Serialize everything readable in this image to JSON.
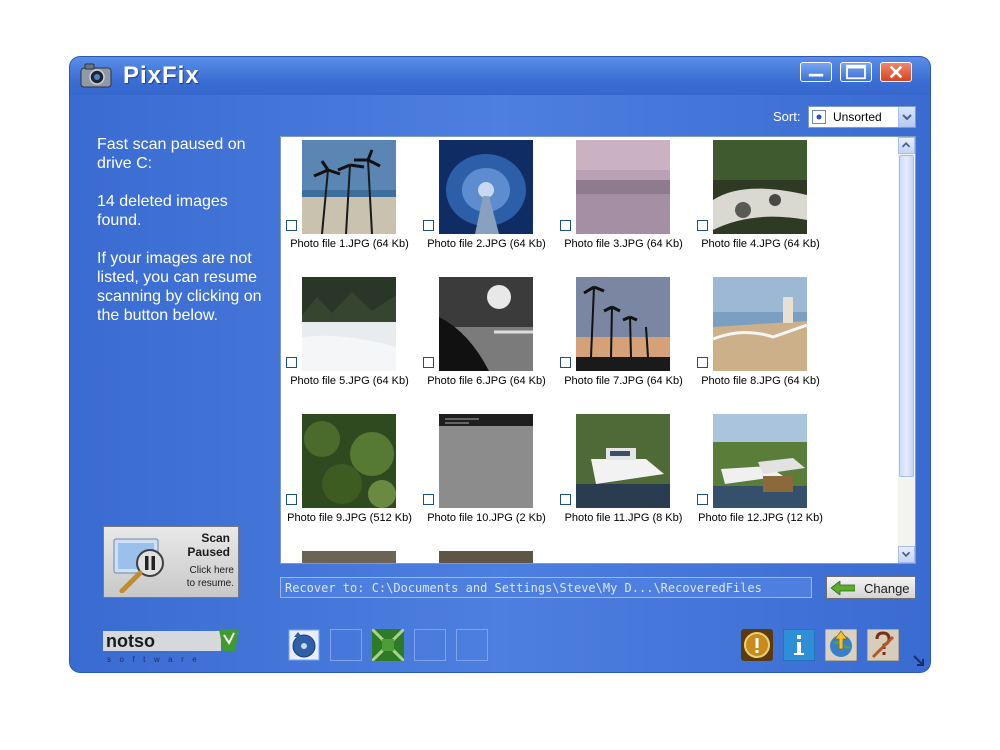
{
  "window": {
    "title": "PixFix"
  },
  "status": {
    "line1": "Fast scan paused on drive C:",
    "line2": "14 deleted images found.",
    "line3": "If your images are not listed, you can resume scanning by clicking on the button below."
  },
  "scan_button": {
    "title_line1": "Scan",
    "title_line2": "Paused",
    "sub_line1": "Click here",
    "sub_line2": "to resume."
  },
  "sort": {
    "label": "Sort:",
    "value": "Unsorted"
  },
  "photos": [
    {
      "name": "Photo file 1.JPG (64 Kb)"
    },
    {
      "name": "Photo file 2.JPG (64 Kb)"
    },
    {
      "name": "Photo file 3.JPG (64 Kb)"
    },
    {
      "name": "Photo file 4.JPG (64 Kb)"
    },
    {
      "name": "Photo file 5.JPG (64 Kb)"
    },
    {
      "name": "Photo file 6.JPG (64 Kb)"
    },
    {
      "name": "Photo file 7.JPG (64 Kb)"
    },
    {
      "name": "Photo file 8.JPG (64 Kb)"
    },
    {
      "name": "Photo file 9.JPG (512 Kb)"
    },
    {
      "name": "Photo file 10.JPG (2 Kb)"
    },
    {
      "name": "Photo file 11.JPG (8 Kb)"
    },
    {
      "name": "Photo file 12.JPG (12 Kb)"
    }
  ],
  "recover": {
    "text": "Recover to: C:\\Documents and Settings\\Steve\\My D...\\RecoveredFiles"
  },
  "change_button": {
    "label": "Change"
  },
  "logo": {
    "text": "notso",
    "subtext": "software"
  },
  "icons": {
    "app": "camera-icon",
    "toolbar_left": [
      "recover-disk-icon",
      "empty-slot",
      "crop-icon",
      "empty-slot",
      "empty-slot"
    ],
    "toolbar_right": [
      "warning-icon",
      "info-icon",
      "web-update-icon",
      "help-icon"
    ]
  },
  "colors": {
    "window_blue": "#3d6ed3",
    "close_red": "#d7441f"
  }
}
